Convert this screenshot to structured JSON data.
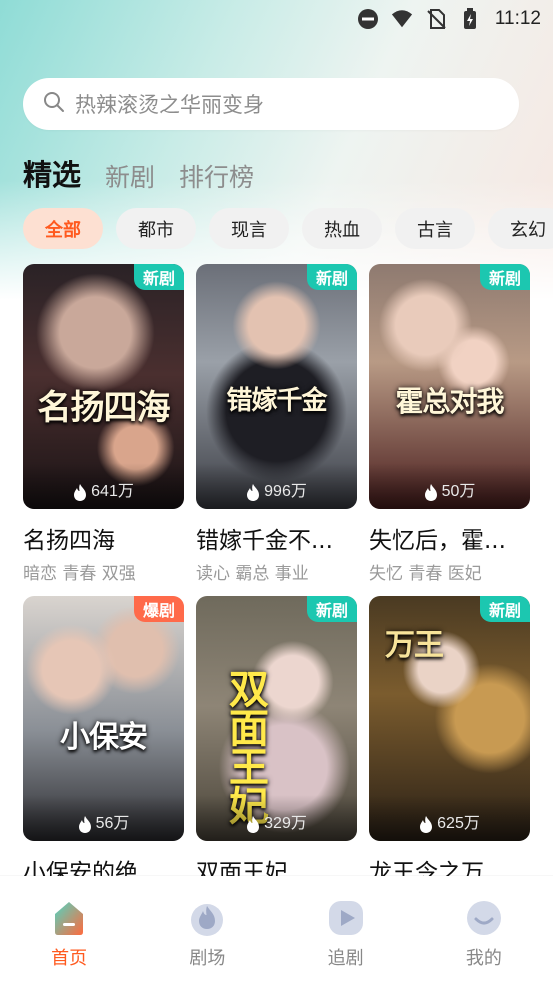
{
  "status_bar": {
    "time": "11:12"
  },
  "search": {
    "placeholder": "热辣滚烫之华丽变身"
  },
  "tabs": [
    {
      "label": "精选"
    },
    {
      "label": "新剧"
    },
    {
      "label": "排行榜"
    }
  ],
  "chips": [
    {
      "label": "全部"
    },
    {
      "label": "都市"
    },
    {
      "label": "现言"
    },
    {
      "label": "热血"
    },
    {
      "label": "古言"
    },
    {
      "label": "玄幻"
    }
  ],
  "dramas": [
    {
      "poster_text": "名扬四海",
      "badge": "新剧",
      "views": "641万",
      "title": "名扬四海",
      "tags": "暗恋  青春 双强"
    },
    {
      "poster_text": "错嫁千金",
      "badge": "新剧",
      "views": "996万",
      "title": "错嫁千金不...",
      "tags": "读心  霸总  事业"
    },
    {
      "poster_text": "霍总对我",
      "badge": "新剧",
      "views": "50万",
      "title": "失忆后，霍...",
      "tags": "失忆  青春 医妃"
    },
    {
      "poster_text": "小保安",
      "badge": "爆剧",
      "views": "56万",
      "title": "小保安的绝",
      "tags": ""
    },
    {
      "poster_text": "双面王妃",
      "badge": "新剧",
      "views": "329万",
      "title": "双面王妃",
      "tags": ""
    },
    {
      "poster_text": "万王",
      "badge": "新剧",
      "views": "625万",
      "title": "龙王令之万",
      "tags": ""
    }
  ],
  "bottom_nav": [
    {
      "label": "首页"
    },
    {
      "label": "剧场"
    },
    {
      "label": "追剧"
    },
    {
      "label": "我的"
    }
  ],
  "colors": {
    "accent": "#ff5a1f",
    "badge_new": "#1cc7b0",
    "badge_hot": "#ff6a4a"
  }
}
